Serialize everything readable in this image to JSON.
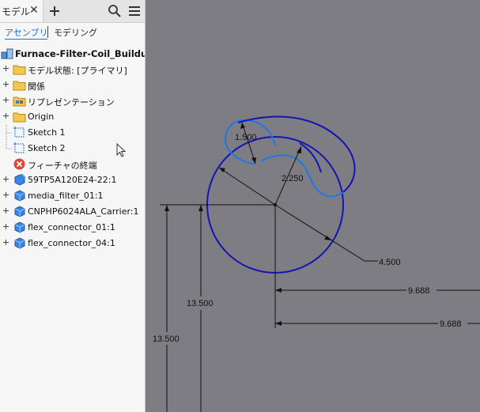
{
  "browser": {
    "tab_label": "モデル",
    "close_glyph": "✕",
    "icons": [
      "add-icon",
      "search-icon",
      "menu-icon"
    ],
    "mode_assembly": "アセンブリ",
    "mode_modeling": "モデリング",
    "root_label": "Furnace-Filter-Coil_Buildup",
    "items": [
      {
        "label": "モデル状態: [プライマリ]",
        "icon": "folder-icon"
      },
      {
        "label": "関係",
        "icon": "folder-icon"
      },
      {
        "label": "リプレゼンテーション",
        "icon": "representations-folder-icon"
      },
      {
        "label": "Origin",
        "icon": "folder-icon"
      },
      {
        "label": "Sketch 1",
        "icon": "sketch-icon"
      },
      {
        "label": "Sketch 2",
        "icon": "sketch-icon"
      },
      {
        "label": "フィーチャの終端",
        "icon": "end-of-features-icon"
      },
      {
        "label": "59TP5A120E24-22:1",
        "icon": "component-icon"
      },
      {
        "label": "media_filter_01:1",
        "icon": "part-icon"
      },
      {
        "label": "CNPHP6024ALA_Carrier:1",
        "icon": "part-icon"
      },
      {
        "label": "flex_connector_01:1",
        "icon": "part-icon"
      },
      {
        "label": "flex_connector_04:1",
        "icon": "part-icon"
      }
    ]
  },
  "sketch": {
    "dimensions": {
      "d1": "1.500",
      "d2": "2.250",
      "d3": "4.500",
      "d4": "9.688",
      "d5": "9.688",
      "d6": "13.500",
      "d7": "13.500"
    },
    "colors": {
      "background": "#7d7d83",
      "outer_curve": "#1414b4",
      "inner_curve": "#1e78e6",
      "dimension_line": "#111111"
    }
  }
}
